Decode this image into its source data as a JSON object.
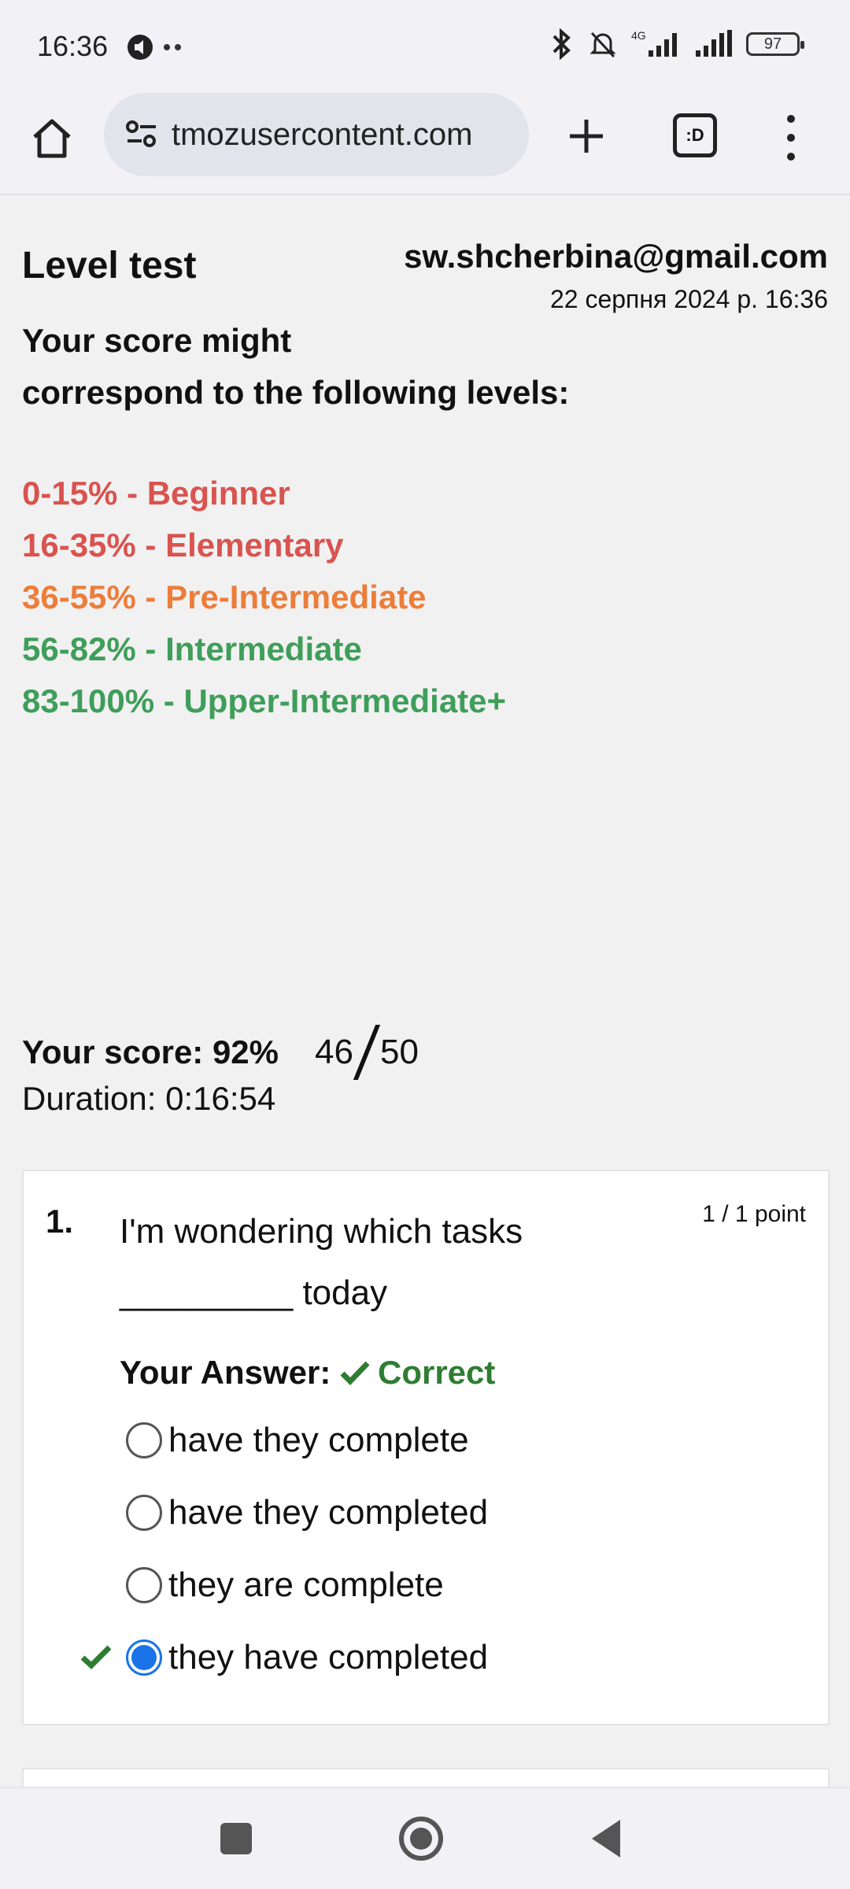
{
  "status_bar": {
    "time": "16:36",
    "network_label": "4G",
    "battery": "97"
  },
  "browser": {
    "url": "tmozusercontent.com",
    "tabs_label": ":D"
  },
  "page": {
    "title": "Level test",
    "email": "sw.shcherbina@gmail.com",
    "timestamp": "22 серпня 2024 р. 16:36",
    "intro_line1": "Your score might",
    "intro_line2": "correspond to the following levels:",
    "levels": [
      {
        "text": "0-15% - Beginner",
        "color": "#d9534f"
      },
      {
        "text": "16-35% - Elementary",
        "color": "#d9534f"
      },
      {
        "text": "36-55% - Pre-Intermediate",
        "color": "#ed7d3a"
      },
      {
        "text": "56-82% - Intermediate",
        "color": "#3e9e5a"
      },
      {
        "text": "83-100% - Upper-Intermediate+",
        "color": "#3e9e5a"
      }
    ],
    "score_label": "Your score: 92%",
    "score_numerator": "46",
    "score_denominator": "50",
    "duration": "Duration: 0:16:54"
  },
  "question": {
    "number": "1.",
    "points": "1 / 1 point",
    "text_line1": "I'm wondering which tasks",
    "text_line2": "_________ today",
    "answer_label": "Your Answer:",
    "answer_status": "Correct",
    "options": [
      {
        "text": "have they complete",
        "selected": false
      },
      {
        "text": "have they completed",
        "selected": false
      },
      {
        "text": "they are complete",
        "selected": false
      },
      {
        "text": "they have completed",
        "selected": true
      }
    ]
  }
}
